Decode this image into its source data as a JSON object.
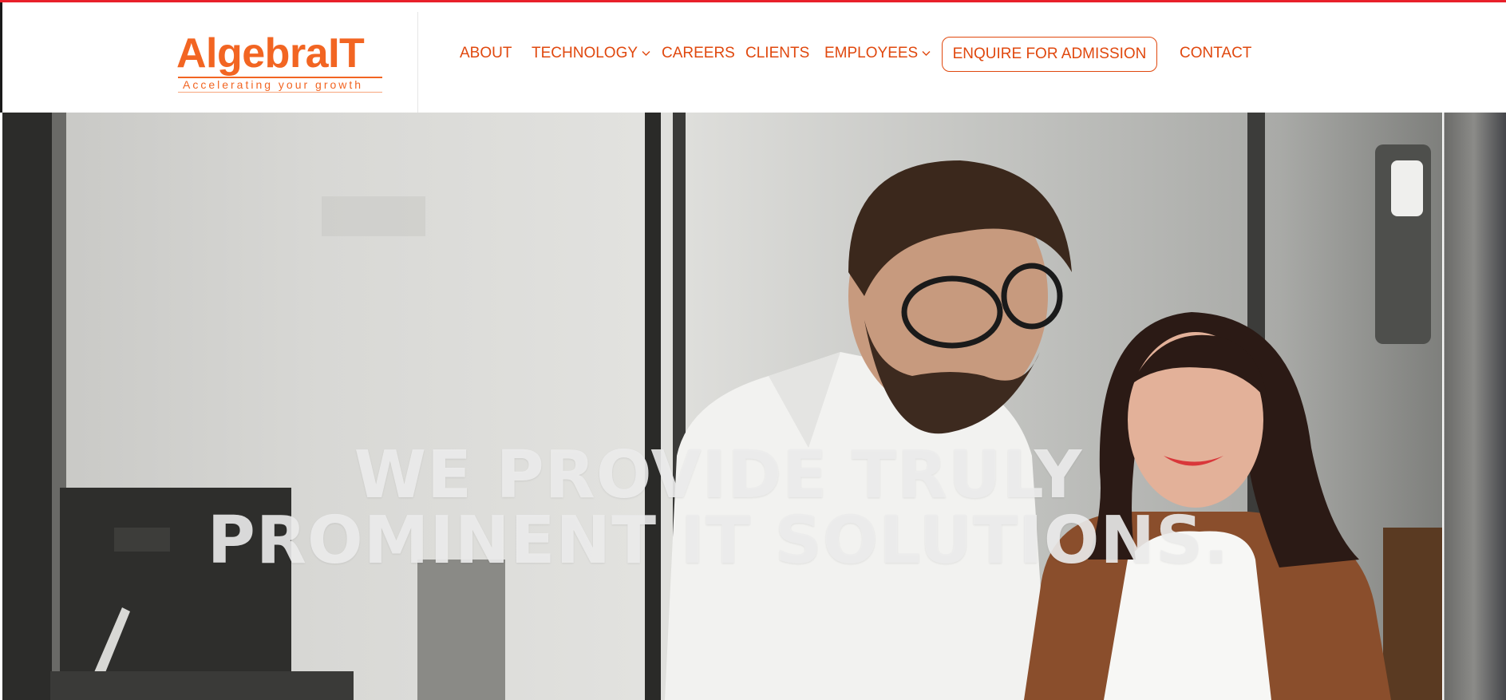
{
  "brand": {
    "name": "AlgebraIT",
    "tagline": "Accelerating your growth",
    "accent_color": "#e0480e",
    "top_border_color": "#e8202a"
  },
  "nav": {
    "items": [
      {
        "label": "ABOUT",
        "has_dropdown": false
      },
      {
        "label": "TECHNOLOGY",
        "has_dropdown": true
      },
      {
        "label": "CAREERS",
        "has_dropdown": false
      },
      {
        "label": "CLIENTS",
        "has_dropdown": false
      },
      {
        "label": "EMPLOYEES",
        "has_dropdown": true
      }
    ],
    "cta_label": "ENQUIRE FOR ADMISSION",
    "contact_label": "CONTACT",
    "dropdown_icon": "chevron-down-icon"
  },
  "hero": {
    "heading_line1": "WE PROVIDE TRULY",
    "heading_line2": "PROMINENT IT SOLUTIONS."
  }
}
